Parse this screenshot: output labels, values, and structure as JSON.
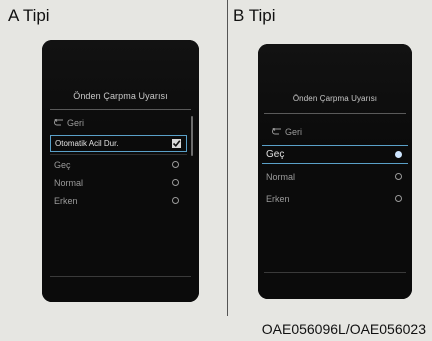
{
  "panel_a": {
    "label": "A Tipi",
    "menu_title": "Önden Çarpma Uyarısı",
    "back_label": "Geri",
    "items": [
      {
        "label": "Otomatik Acil Dur.",
        "control": "checkbox",
        "checked": true,
        "selected": true
      },
      {
        "label": "Geç",
        "control": "radio",
        "checked": false,
        "selected": false
      },
      {
        "label": "Normal",
        "control": "radio",
        "checked": false,
        "selected": false
      },
      {
        "label": "Erken",
        "control": "radio",
        "checked": false,
        "selected": false
      }
    ]
  },
  "panel_b": {
    "label": "B Tipi",
    "menu_title": "Önden Çarpma Uyarısı",
    "back_label": "Geri",
    "items": [
      {
        "label": "Geç",
        "control": "radio",
        "checked": true,
        "selected": true
      },
      {
        "label": "Normal",
        "control": "radio",
        "checked": false,
        "selected": false
      },
      {
        "label": "Erken",
        "control": "radio",
        "checked": false,
        "selected": false
      }
    ]
  },
  "caption": "OAE056096L/OAE056023",
  "colors": {
    "background": "#e6e6e2",
    "screen": "#0b0b0b",
    "selection_border": "#5aa0c8",
    "text": "#9a9a9a"
  },
  "icons": {
    "back": "return-arrow-icon",
    "check": "checkmark-icon"
  }
}
